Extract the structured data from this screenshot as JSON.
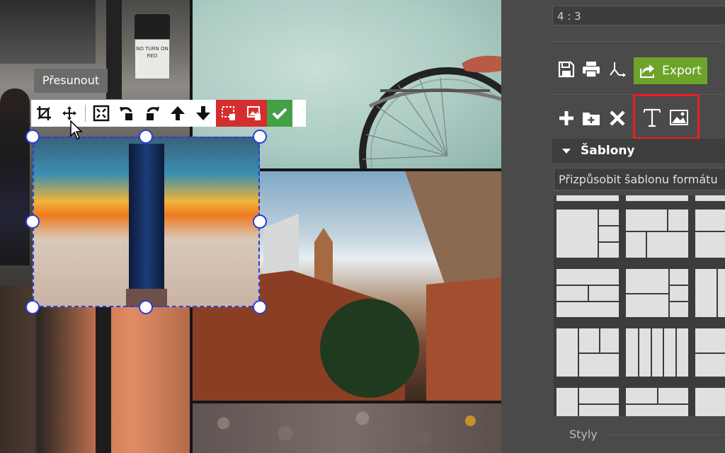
{
  "tooltip": {
    "text": "Přesunout"
  },
  "street_sign": {
    "text": "NO TURN ON RED"
  },
  "float_toolbar": {
    "buttons": [
      {
        "name": "crop-button",
        "icon": "crop-icon"
      },
      {
        "name": "move-button",
        "icon": "move-icon"
      },
      {
        "name": "fit-button",
        "icon": "expand-icon"
      },
      {
        "name": "rotate-left-button",
        "icon": "rotate-left-icon"
      },
      {
        "name": "rotate-right-button",
        "icon": "rotate-right-icon"
      },
      {
        "name": "bring-forward-button",
        "icon": "arrow-up-icon"
      },
      {
        "name": "send-backward-button",
        "icon": "arrow-down-icon"
      },
      {
        "name": "delete-frame-button",
        "icon": "delete-frame-icon"
      },
      {
        "name": "delete-photo-button",
        "icon": "delete-photo-icon"
      },
      {
        "name": "confirm-button",
        "icon": "check-icon"
      }
    ],
    "colors": {
      "red": "#d32f2f",
      "green": "#43a047"
    }
  },
  "panel": {
    "ratio": "4 : 3",
    "export_label": "Export",
    "export_color": "#6ea32a",
    "highlight_color": "#ee1d23",
    "templates_section": "Šablony",
    "template_select": "Přizpůsobit šablonu formátu",
    "styles_section": "Styly"
  }
}
